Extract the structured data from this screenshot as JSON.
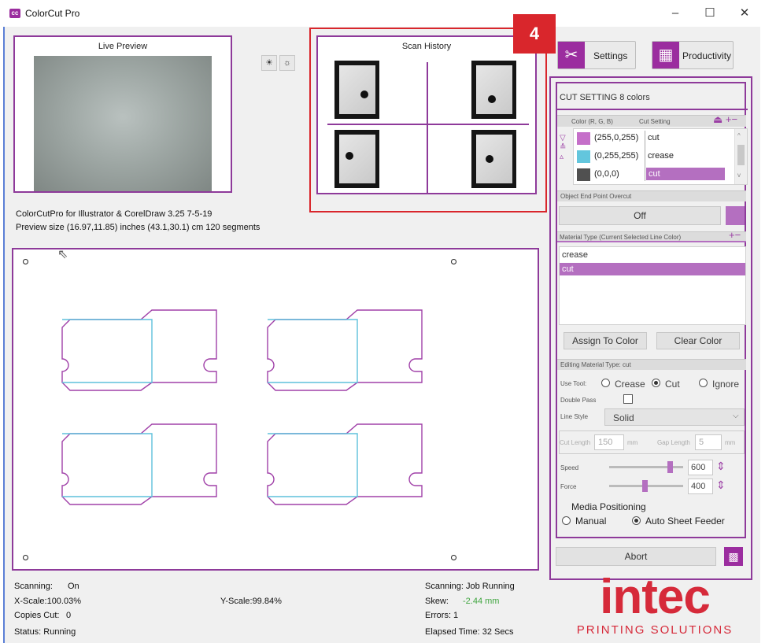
{
  "window": {
    "icon": "cc",
    "title": "ColorCut Pro"
  },
  "live_preview": {
    "label": "Live Preview"
  },
  "scan_history": {
    "label": "Scan History",
    "badge": "4"
  },
  "info": {
    "version": "ColorCutPro for Illustrator & CorelDraw 3.25 7-5-19",
    "preview_size": "Preview size (16.97,11.85) inches  (43.1,30.1) cm   120 segments"
  },
  "toolbar": {
    "settings": "Settings",
    "productivity": "Productivity"
  },
  "cut_setting": {
    "header": "CUT SETTING  8 colors",
    "col_color": "Color (R, G, B)",
    "col_cut": "Cut Setting",
    "rows": [
      {
        "rgb": "(255,0,255)",
        "setting": "cut",
        "swatch": "#c56fc9"
      },
      {
        "rgb": "(0,255,255)",
        "setting": "crease",
        "swatch": "#63c6dd"
      },
      {
        "rgb": "(0,0,0)",
        "setting": "cut",
        "swatch": "#505050"
      }
    ]
  },
  "overcut": {
    "label": "Object End Point Overcut",
    "value": "Off"
  },
  "material": {
    "label": "Material Type (Current Selected Line Color)",
    "items": [
      "crease",
      "cut"
    ],
    "assign": "Assign To Color",
    "clear": "Clear Color"
  },
  "editing": {
    "label": "Editing Material Type: cut",
    "use_tool": "Use Tool:",
    "options": [
      "Crease",
      "Cut",
      "Ignore"
    ],
    "selected": "Cut",
    "double_pass": "Double Pass",
    "line_style_label": "Line Style",
    "line_style": "Solid",
    "cut_length_label": "Cut Length",
    "cut_length": "150",
    "gap_length_label": "Gap Length",
    "gap_length": "5",
    "unit": "mm",
    "speed_label": "Speed",
    "speed": "600",
    "speed_level": 0.85,
    "force_label": "Force",
    "force": "400",
    "force_level": 0.48
  },
  "media": {
    "label": "Media Positioning",
    "manual": "Manual",
    "auto": "Auto Sheet Feeder"
  },
  "abort": "Abort",
  "status": {
    "scanning_label": "Scanning:",
    "scanning_value": "On",
    "x_scale": "X-Scale:100.03%",
    "y_scale": "Y-Scale:99.84%",
    "copies_label": "Copies Cut:",
    "copies_value": "0",
    "status": "Status: Running",
    "job": "Scanning: Job Running",
    "skew_label": "Skew:",
    "skew_value": "-2.44 mm",
    "errors": "Errors: 1",
    "elapsed": "Elapsed Time: 32 Secs"
  },
  "brand": {
    "name": "intec",
    "tagline": "PRINTING SOLUTIONS"
  },
  "colors": {
    "accent": "#8e3a9a",
    "brand_red": "#d62a3a",
    "cut_line": "#a040a8",
    "crease_line": "#5ec0dc"
  }
}
